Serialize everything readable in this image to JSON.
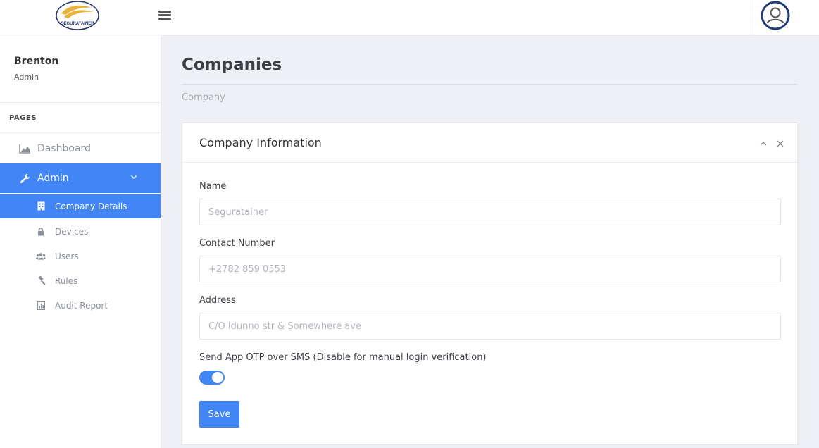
{
  "brand": {
    "logo_text": "SEGURATAINER",
    "colors": {
      "logo_gold": "#e8b13a",
      "logo_navy": "#1f2d6b",
      "accent": "#4285f4"
    }
  },
  "header": {
    "menu_icon": "hamburger-icon",
    "avatar_icon": "user-circle-icon"
  },
  "sidebar": {
    "user": {
      "name": "Brenton",
      "role": "Admin"
    },
    "section_label": "PAGES",
    "items": [
      {
        "label": "Dashboard",
        "icon": "area-chart-icon"
      },
      {
        "label": "Admin",
        "icon": "wrench-icon",
        "expanded": true
      }
    ],
    "sub_items": [
      {
        "label": "Company Details",
        "icon": "building-icon",
        "active": true
      },
      {
        "label": "Devices",
        "icon": "lock-icon"
      },
      {
        "label": "Users",
        "icon": "users-icon"
      },
      {
        "label": "Rules",
        "icon": "gavel-icon"
      },
      {
        "label": "Audit Report",
        "icon": "report-icon"
      }
    ]
  },
  "main": {
    "title": "Companies",
    "breadcrumb": "Company",
    "card": {
      "title": "Company Information",
      "fields": [
        {
          "label": "Name",
          "value": "",
          "placeholder": "Seguratainer"
        },
        {
          "label": "Contact Number",
          "value": "",
          "placeholder": "+2782 859 0553"
        },
        {
          "label": "Address",
          "value": "",
          "placeholder": "C/O Idunno str & Somewhere ave"
        }
      ],
      "otp_toggle": {
        "label": "Send App OTP over SMS (Disable for manual login verification)",
        "enabled": true
      },
      "save_label": "Save"
    }
  }
}
